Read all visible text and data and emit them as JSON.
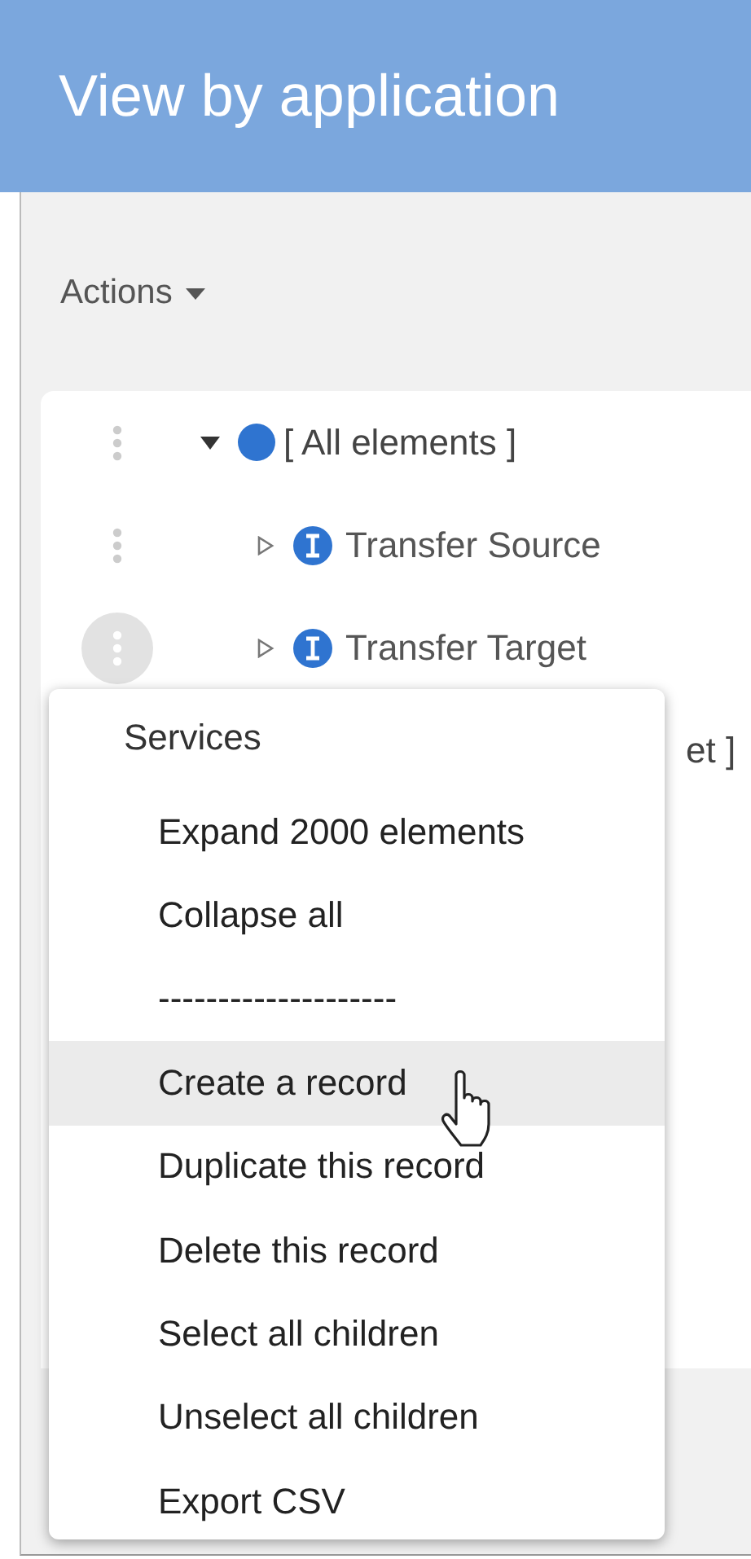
{
  "header": {
    "title": "View by application"
  },
  "actions": {
    "label": "Actions"
  },
  "tree": [
    {
      "label": "[ All elements ]",
      "kind": "group",
      "expanded": true,
      "active": false,
      "children": [
        {
          "label": "Transfer Source",
          "kind": "item",
          "expanded": false,
          "active": false
        },
        {
          "label": "Transfer Target",
          "kind": "item",
          "expanded": false,
          "active": true
        }
      ]
    }
  ],
  "covered_row": {
    "label": "et ]"
  },
  "menu": {
    "title": "Services",
    "items": [
      {
        "label": "Expand 2000 elements",
        "selected": false
      },
      {
        "label": "Collapse all",
        "selected": false
      },
      {
        "label": "--------------------",
        "selected": false
      },
      {
        "label": "Create a record",
        "selected": true
      },
      {
        "label": "Duplicate this record",
        "selected": false
      },
      {
        "label": "Delete this record",
        "selected": false
      },
      {
        "label": "Select all children",
        "selected": false
      },
      {
        "label": "Unselect all children",
        "selected": false
      },
      {
        "label": "Export CSV",
        "selected": false
      }
    ]
  }
}
